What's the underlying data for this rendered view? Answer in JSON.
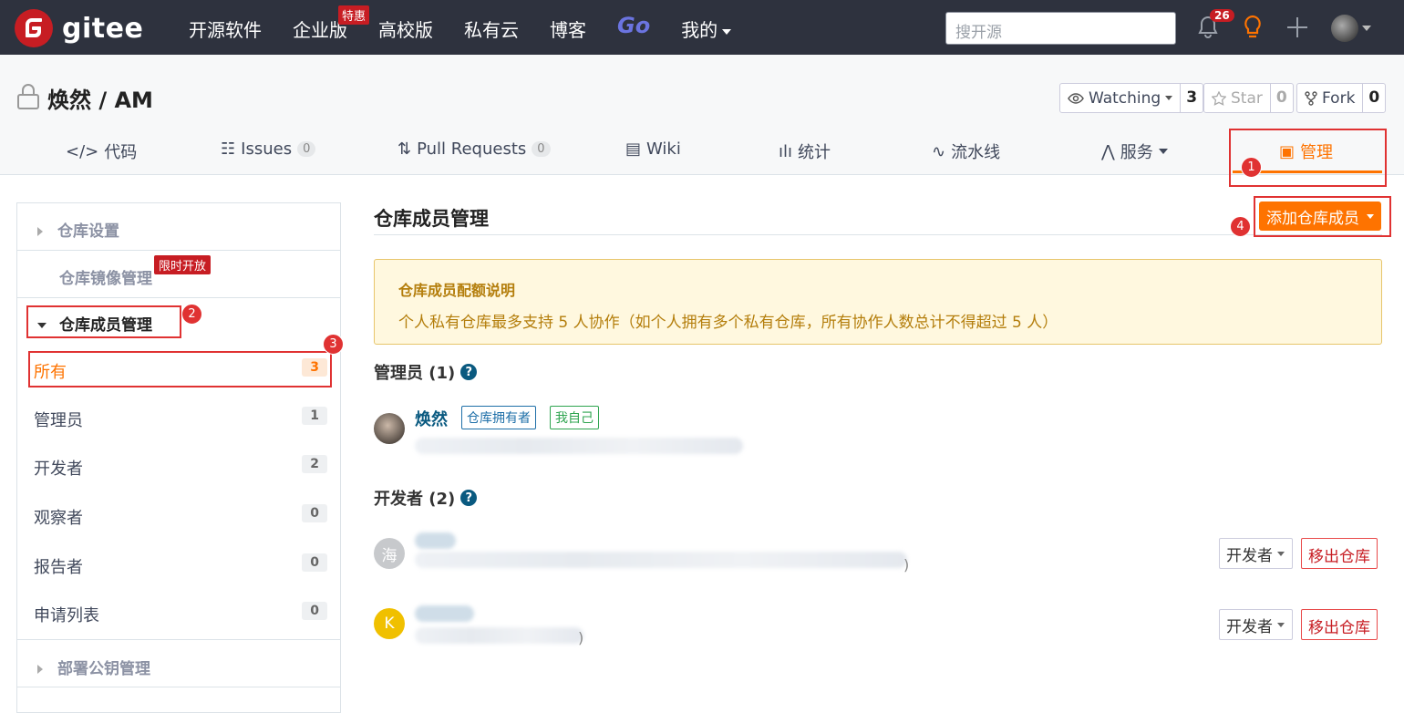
{
  "topbar": {
    "brand": "gitee",
    "nav": [
      {
        "label": "开源软件"
      },
      {
        "label": "企业版",
        "badge": "特惠"
      },
      {
        "label": "高校版"
      },
      {
        "label": "私有云"
      },
      {
        "label": "博客"
      },
      {
        "label": "Go"
      },
      {
        "label": "我的"
      }
    ],
    "search_placeholder": "搜开源",
    "notification_count": "26"
  },
  "repo": {
    "title": "焕然 / AM",
    "watch_label": "Watching",
    "watch_count": "3",
    "star_label": "Star",
    "star_count": "0",
    "fork_label": "Fork",
    "fork_count": "0"
  },
  "tabs": [
    {
      "label": "代码",
      "icon": "code-icon"
    },
    {
      "label": "Issues",
      "count": "0",
      "icon": "issues-icon"
    },
    {
      "label": "Pull Requests",
      "count": "0",
      "icon": "pull-request-icon"
    },
    {
      "label": "Wiki",
      "icon": "wiki-icon"
    },
    {
      "label": "统计",
      "icon": "chart-icon"
    },
    {
      "label": "流水线",
      "icon": "pipeline-icon"
    },
    {
      "label": "服务",
      "icon": "pulse-icon"
    },
    {
      "label": "管理",
      "icon": "doc-icon",
      "active": true
    }
  ],
  "sidebar": {
    "repo_settings": "仓库设置",
    "mirror": "仓库镜像管理",
    "mirror_badge": "限时开放",
    "members": "仓库成员管理",
    "items": [
      {
        "label": "所有",
        "count": "3",
        "active": true
      },
      {
        "label": "管理员",
        "count": "1"
      },
      {
        "label": "开发者",
        "count": "2"
      },
      {
        "label": "观察者",
        "count": "0"
      },
      {
        "label": "报告者",
        "count": "0"
      },
      {
        "label": "申请列表",
        "count": "0"
      }
    ],
    "deploy_keys": "部署公钥管理"
  },
  "main": {
    "title": "仓库成员管理",
    "add_button": "添加仓库成员",
    "notice_title": "仓库成员配额说明",
    "notice_text": "个人私有仓库最多支持 5 人协作（如个人拥有多个私有仓库，所有协作人数总计不得超过 5 人）",
    "admins_title": "管理员 (1)",
    "admin": {
      "name": "焕然",
      "tag_owner": "仓库拥有者",
      "tag_self": "我自己"
    },
    "devs_title": "开发者 (2)",
    "devs": [
      {
        "avatar": "海",
        "role": "开发者",
        "remove": "移出仓库",
        "trailing": ")"
      },
      {
        "avatar": "K",
        "role": "开发者",
        "remove": "移出仓库",
        "trailing": ")"
      }
    ]
  },
  "annotations": [
    "1",
    "2",
    "3",
    "4"
  ],
  "colors": {
    "brand": "#c71d23",
    "accent": "#fe7300",
    "topbar": "#2e323e",
    "annotation": "#e03232"
  }
}
